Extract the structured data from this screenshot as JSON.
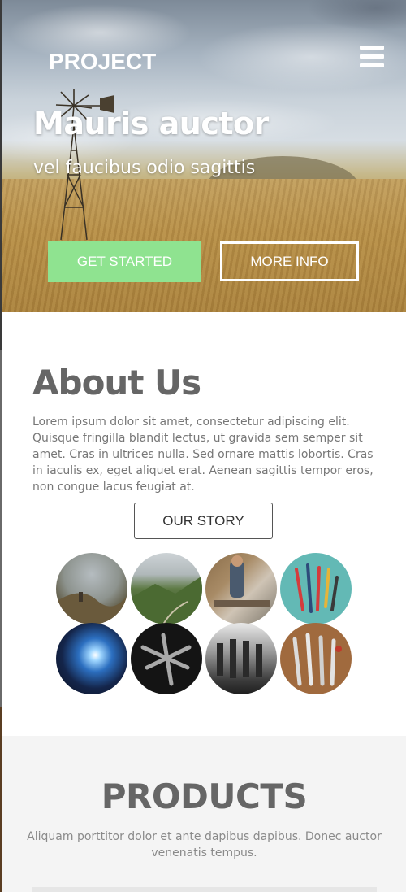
{
  "header": {
    "brand": "PROJECT",
    "menu_icon": "hamburger-menu-icon"
  },
  "hero": {
    "title": "Mauris auctor",
    "subtitle": "vel faucibus odio sagittis",
    "primary_button": "GET STARTED",
    "secondary_button": "MORE INFO",
    "colors": {
      "primary_button_bg": "#8fe390",
      "text": "#ffffff"
    }
  },
  "about": {
    "title": "About Us",
    "text": "Lorem ipsum dolor sit amet, consectetur adipiscing elit. Quisque fringilla blandit lectus, ut gravida sem semper sit amet. Cras in ultrices nulla. Sed ornare mattis lobortis. Cras in iaculis ex, eget aliquet erat. Aenean sagittis tempor eros, non congue lacus feugiat at.",
    "button": "OUR STORY"
  },
  "gallery": [
    {
      "name": "gallery-photo-foggy-hill"
    },
    {
      "name": "gallery-photo-green-valley"
    },
    {
      "name": "gallery-photo-workshop"
    },
    {
      "name": "gallery-photo-tools-teal"
    },
    {
      "name": "gallery-photo-welding"
    },
    {
      "name": "gallery-photo-pliers"
    },
    {
      "name": "gallery-photo-machinery"
    },
    {
      "name": "gallery-photo-knives"
    }
  ],
  "products": {
    "title": "PRODUCTS",
    "text": "Aliquam porttitor dolor et ante dapibus dapibus. Donec auctor venenatis tempus."
  }
}
